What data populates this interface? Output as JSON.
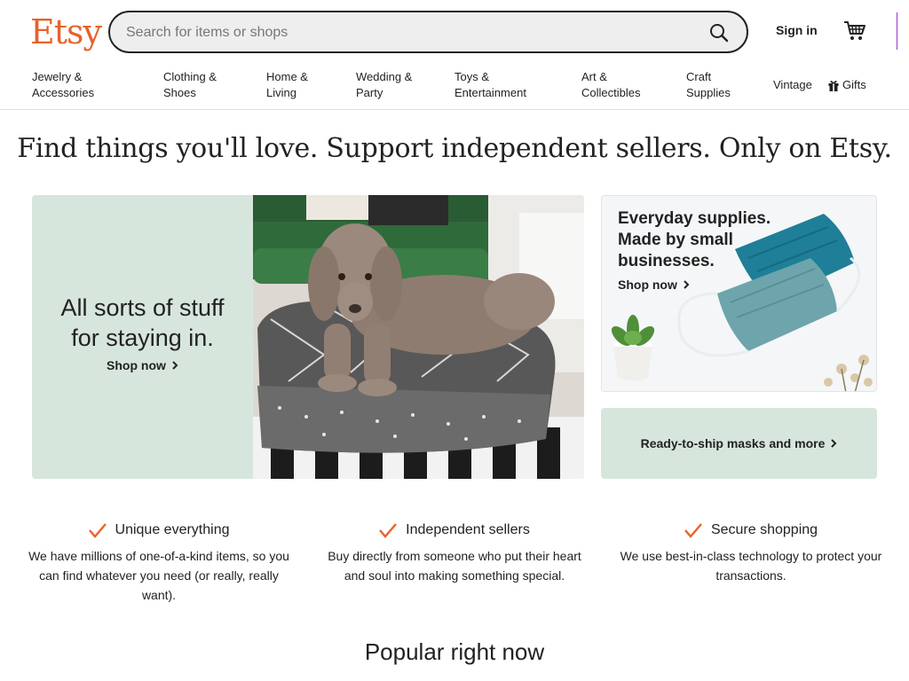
{
  "header": {
    "logo": "Etsy",
    "search": {
      "placeholder": "Search for items or shops",
      "value": ""
    },
    "sign_in": "Sign in"
  },
  "categories": [
    {
      "line1": "Jewelry &",
      "line2": "Accessories"
    },
    {
      "line1": "Clothing &",
      "line2": "Shoes"
    },
    {
      "line1": "Home &",
      "line2": "Living"
    },
    {
      "line1": "Wedding &",
      "line2": "Party"
    },
    {
      "line1": "Toys &",
      "line2": "Entertainment"
    },
    {
      "line1": "Art &",
      "line2": "Collectibles"
    },
    {
      "line1": "Craft",
      "line2": "Supplies"
    },
    {
      "line1": "Vintage",
      "line2": ""
    },
    {
      "line1": "Gifts",
      "line2": ""
    }
  ],
  "hero": {
    "title": "Find things you'll love. Support independent sellers. Only on Etsy."
  },
  "banner_left": {
    "line1": "All sorts of stuff",
    "line2": "for staying in.",
    "cta": "Shop now"
  },
  "banner_right_top": {
    "line1": "Everyday supplies.",
    "line2": "Made by small",
    "line3": "businesses.",
    "cta": "Shop now"
  },
  "banner_right_bottom": {
    "cta": "Ready-to-ship masks and more"
  },
  "value_props": [
    {
      "title": "Unique everything",
      "line1": "We have millions of one-of-a-kind items, so you",
      "line2": "can find whatever you need (or really, really",
      "line3": "want)."
    },
    {
      "title": "Independent sellers",
      "line1": "Buy directly from someone who put their heart",
      "line2": "and soul into making something special.",
      "line3": ""
    },
    {
      "title": "Secure shopping",
      "line1": "We use best-in-class technology to protect your",
      "line2": "transactions.",
      "line3": ""
    }
  ],
  "popular": {
    "title": "Popular right now"
  },
  "colors": {
    "brand": "#e8622a",
    "mint": "#d7e6dd",
    "check": "#e8622a"
  }
}
